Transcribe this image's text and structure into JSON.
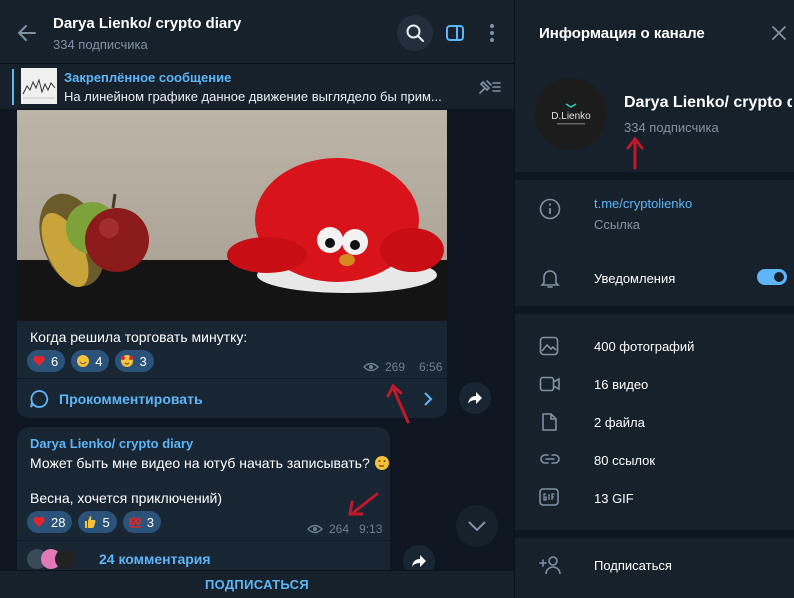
{
  "header": {
    "title": "Darya Lienko/ crypto diary",
    "subtitle": "334 подписчика"
  },
  "pinned": {
    "title": "Закреплённое сообщение",
    "text": "На линейном графике данное движение выглядело бы прим..."
  },
  "messages": [
    {
      "caption": "Когда решила торговать минутку:",
      "reactions": [
        {
          "emoji": "heart",
          "count": "6"
        },
        {
          "emoji": "grin",
          "count": "4"
        },
        {
          "emoji": "hearts-face",
          "count": "3"
        }
      ],
      "views": "269",
      "time": "6:56",
      "comment_label": "Прокомментировать"
    },
    {
      "sender": "Darya Lienko/ crypto diary",
      "line1": "Может быть мне видео на ютуб начать записывать?",
      "line2": "Весна, хочется приключений)",
      "reactions": [
        {
          "emoji": "heart",
          "count": "28"
        },
        {
          "emoji": "thumbs-up",
          "count": "5"
        },
        {
          "emoji": "hundred",
          "count": "3"
        }
      ],
      "views": "264",
      "time": "9:13",
      "comments": "24 комментария"
    }
  ],
  "subscribe_label": "ПОДПИСАТЬСЯ",
  "info_panel": {
    "title": "Информация о канале",
    "avatar_text": "D.Lienko",
    "channel_name": "Darya Lienko/ crypto diary",
    "subscribers": "334 подписчика",
    "link": "t.me/cryptolienko",
    "link_label": "Ссылка",
    "notifications_label": "Уведомления",
    "notifications_on": true,
    "media": [
      {
        "icon": "photo-icon",
        "label": "400 фотографий"
      },
      {
        "icon": "video-icon",
        "label": "16 видео"
      },
      {
        "icon": "file-icon",
        "label": "2 файла"
      },
      {
        "icon": "link-icon",
        "label": "80 ссылок"
      },
      {
        "icon": "gif-icon",
        "label": "13 GIF"
      }
    ],
    "subscribe_row": "Подписаться"
  },
  "colors": {
    "accent": "#5eb5f7",
    "bubble": "#182533",
    "panel": "#17212b",
    "background": "#0e1621",
    "annotation_arrow": "#c0182a"
  }
}
